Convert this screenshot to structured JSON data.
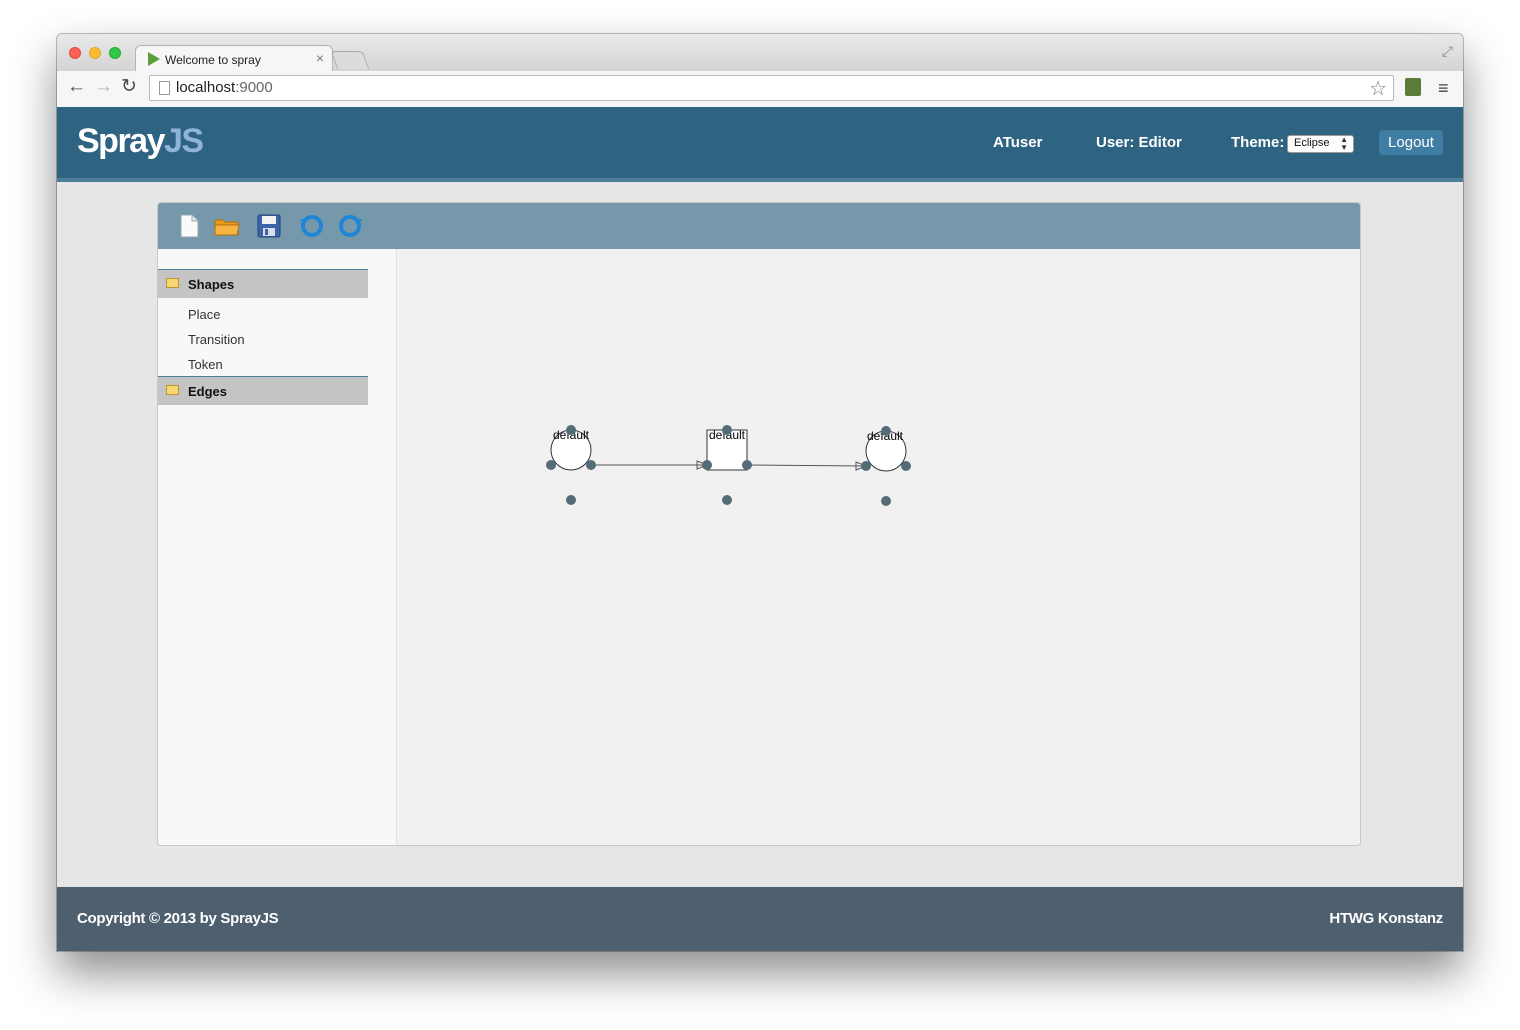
{
  "browser": {
    "tab_title": "Welcome to spray",
    "tab_close": "×",
    "url_host": "localhost",
    "url_port": ":9000"
  },
  "header": {
    "logo_primary": "Spray",
    "logo_accent": "JS",
    "user_name": "ATuser",
    "user_role": "User: Editor",
    "theme_label": "Theme:",
    "theme_value": "Eclipse",
    "logout_label": "Logout",
    "colors": {
      "header_bg": "#2f6382",
      "logo_accent": "#8fb3d9"
    }
  },
  "toolbar": {
    "buttons": [
      "new-file-icon",
      "open-folder-icon",
      "save-icon",
      "undo-icon",
      "redo-icon"
    ]
  },
  "palette": {
    "groups": [
      {
        "label": "Shapes",
        "items": [
          "Place",
          "Transition",
          "Token"
        ]
      },
      {
        "label": "Edges",
        "items": []
      }
    ]
  },
  "diagram": {
    "nodes": [
      {
        "type": "place",
        "label": "default"
      },
      {
        "type": "transition",
        "label": "default"
      },
      {
        "type": "place",
        "label": "default"
      }
    ],
    "edges": [
      {
        "from": 0,
        "to": 1
      },
      {
        "from": 1,
        "to": 2
      }
    ]
  },
  "footer": {
    "copyright": "Copyright © 2013 by SprayJS",
    "org": "HTWG Konstanz"
  }
}
